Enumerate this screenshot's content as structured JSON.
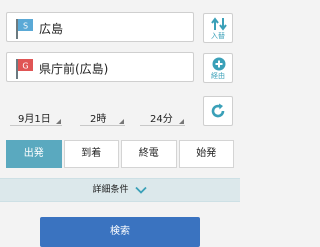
{
  "from": {
    "flag_letter": "S",
    "label": "広島"
  },
  "to": {
    "flag_letter": "G",
    "label": "県庁前(広島)"
  },
  "swap_button": {
    "label": "入替"
  },
  "via_button": {
    "label": "経由"
  },
  "date_time": {
    "date": "9月1日",
    "hour": "2時",
    "minute": "24分"
  },
  "mode_tabs": [
    {
      "label": "出発",
      "active": true
    },
    {
      "label": "到着",
      "active": false
    },
    {
      "label": "終電",
      "active": false
    },
    {
      "label": "始発",
      "active": false
    }
  ],
  "detail_conditions": {
    "label": "詳細条件"
  },
  "search_button": {
    "label": "検索"
  },
  "colors": {
    "start_flag": "#5aa9d6",
    "goal_flag": "#e05555",
    "accent": "#3aa0b8",
    "active_tab": "#5aa9bf",
    "search_button": "#3a73c0"
  }
}
